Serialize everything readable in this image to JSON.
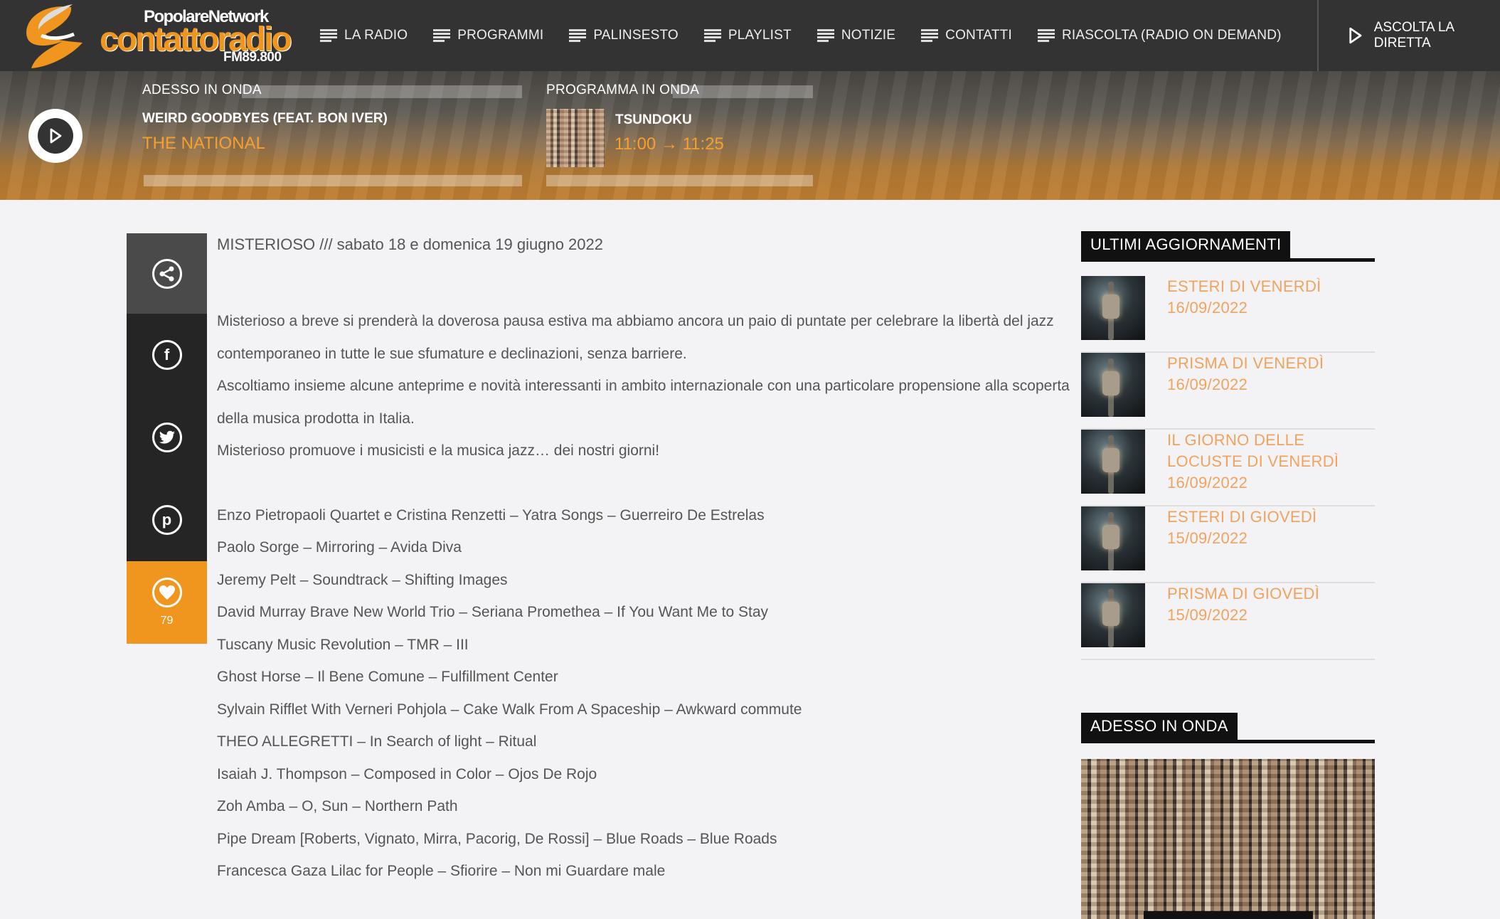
{
  "logo": {
    "network": "PopolareNetwork",
    "name": "contattoradio",
    "frequency": "FM89.800"
  },
  "nav": {
    "items": [
      {
        "label": "LA RADIO",
        "icon": "menu-lines-icon"
      },
      {
        "label": "PROGRAMMI",
        "icon": "menu-lines-icon"
      },
      {
        "label": "PALINSESTO",
        "icon": "menu-lines-icon"
      },
      {
        "label": "PLAYLIST",
        "icon": "menu-lines-icon"
      },
      {
        "label": "NOTIZIE",
        "icon": "menu-lines-icon"
      },
      {
        "label": "CONTATTI",
        "icon": "menu-lines-icon"
      },
      {
        "label": "RIASCOLTA (RADIO ON DEMAND)",
        "icon": "menu-lines-icon"
      }
    ],
    "listen_live": "ASCOLTA LA DIRETTA"
  },
  "now_playing": {
    "label": "ADESSO IN ONDA",
    "song": "WEIRD GOODBYES (FEAT. BON IVER)",
    "artist": "THE NATIONAL"
  },
  "program": {
    "label": "PROGRAMMA IN ONDA",
    "name": "TSUNDOKU",
    "time": "11:00 → 11:25"
  },
  "share": {
    "items": [
      "share-icon",
      "facebook-icon",
      "twitter-icon",
      "pinterest-icon"
    ],
    "like_count": "79"
  },
  "article": {
    "title": "MISTERIOSO /// sabato 18 e domenica 19 giugno 2022",
    "paragraphs": [
      "Misterioso a breve si prenderà la doverosa pausa estiva ma abbiamo ancora un paio di puntate per celebrare la libertà del jazz contemporaneo in tutte le sue sfumature e declinazioni, senza barriere.",
      "Ascoltiamo insieme alcune anteprime e novità interessanti in ambito internazionale con una particolare propensione alla scoperta della musica prodotta in Italia.",
      "Misterioso promuove i musicisti e la musica jazz… dei nostri giorni!"
    ],
    "tracks": [
      "Enzo Pietropaoli Quartet e Cristina Renzetti – Yatra Songs – Guerreiro De Estrelas",
      "Paolo Sorge – Mirroring – Avida Diva",
      "Jeremy Pelt – Soundtrack – Shifting Images",
      "David Murray Brave New World Trio – Seriana Promethea – If You Want Me to Stay",
      "Tuscany Music Revolution – TMR – III",
      "Ghost Horse – Il Bene Comune – Fulfillment Center",
      "Sylvain Rifflet With Verneri Pohjola – Cake Walk From A Spaceship – Awkward commute",
      "THEO ALLEGRETTI – In Search of light – Ritual",
      "Isaiah J. Thompson – Composed in Color – Ojos De Rojo",
      "Zoh Amba – O, Sun – Northern Path",
      "Pipe Dream [Roberts, Vignato, Mirra, Pacorig, De Rossi] – Blue Roads – Blue Roads",
      "Francesca Gaza Lilac for People – Sfiorire – Non mi Guardare male"
    ]
  },
  "sidebar": {
    "updates_title": "ULTIMI AGGIORNAMENTI",
    "updates": [
      "ESTERI DI VENERDÌ 16/09/2022",
      "PRISMA DI VENERDÌ 16/09/2022",
      "IL GIORNO DELLE LOCUSTE DI VENERDÌ 16/09/2022",
      "ESTERI DI GIOVEDÌ 15/09/2022",
      "PRISMA DI GIOVEDÌ 15/09/2022"
    ],
    "on_air_title": "ADESSO IN ONDA"
  },
  "colors": {
    "accent": "#f0951d",
    "header_bg": "#333333",
    "link": "#f0a35e"
  }
}
